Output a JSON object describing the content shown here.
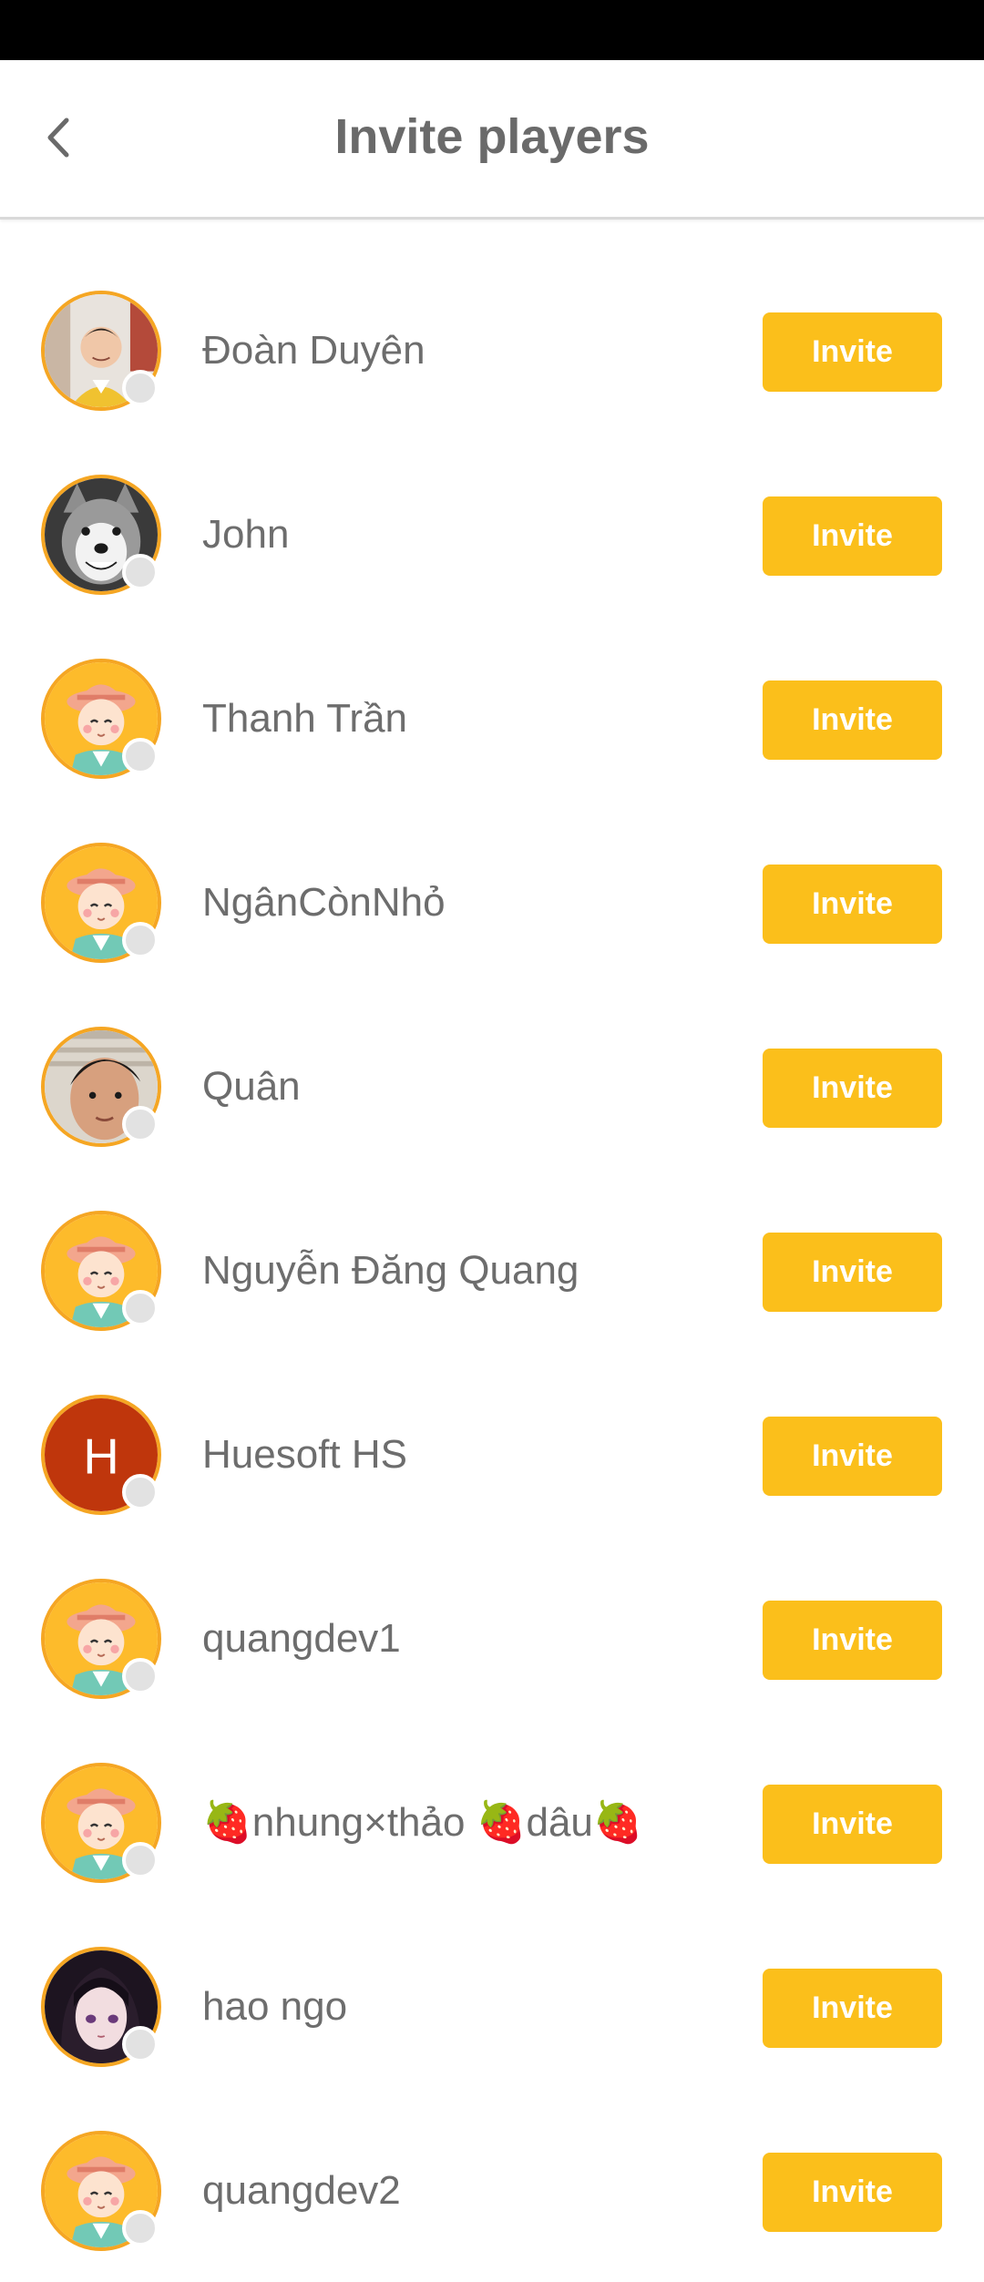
{
  "header": {
    "title": "Invite players",
    "back_icon": "chevron-left-icon"
  },
  "colors": {
    "accent": "#fbbf1b",
    "avatar_ring": "#f5a623",
    "text": "#6d6d6d",
    "status_offline": "#e2e2e2"
  },
  "players": [
    {
      "name": "Đoàn Duyên",
      "avatar": "photo-man-yellow-shirt",
      "invite_label": "Invite"
    },
    {
      "name": "John",
      "avatar": "photo-husky-dog",
      "invite_label": "Invite"
    },
    {
      "name": "Thanh Trần",
      "avatar": "default-farmer-avatar",
      "invite_label": "Invite"
    },
    {
      "name": "NgânCònNhỏ",
      "avatar": "default-farmer-avatar",
      "invite_label": "Invite"
    },
    {
      "name": "Quân",
      "avatar": "photo-child-face",
      "invite_label": "Invite"
    },
    {
      "name": "Nguyễn Đăng Quang",
      "avatar": "default-farmer-avatar",
      "invite_label": "Invite"
    },
    {
      "name": "Huesoft HS",
      "avatar": "letter-avatar",
      "avatar_letter": "H",
      "invite_label": "Invite"
    },
    {
      "name": "quangdev1",
      "avatar": "default-farmer-avatar",
      "invite_label": "Invite"
    },
    {
      "name": "🍓nhung×thảo 🍓dâu🍓",
      "avatar": "default-farmer-avatar",
      "invite_label": "Invite"
    },
    {
      "name": "hao ngo",
      "avatar": "photo-anime-girl",
      "invite_label": "Invite"
    },
    {
      "name": "quangdev2",
      "avatar": "default-farmer-avatar",
      "invite_label": "Invite"
    }
  ]
}
